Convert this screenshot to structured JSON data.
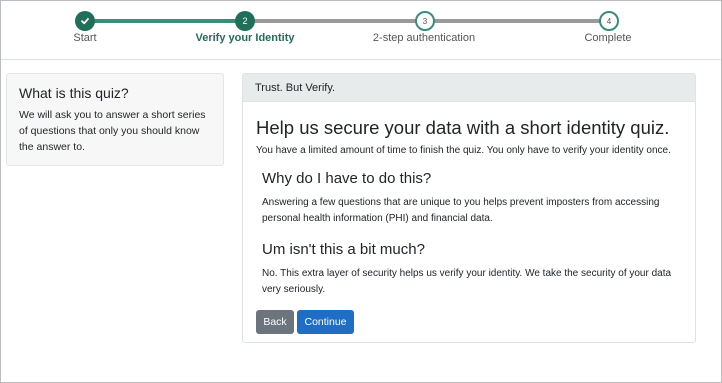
{
  "stepper": {
    "steps": [
      {
        "label": "Start",
        "number": "",
        "state": "done"
      },
      {
        "label": "Verify your Identity",
        "number": "2",
        "state": "active"
      },
      {
        "label": "2-step authentication",
        "number": "3",
        "state": "todo"
      },
      {
        "label": "Complete",
        "number": "4",
        "state": "todo"
      }
    ]
  },
  "sidebar": {
    "title": "What is this quiz?",
    "text": "We will ask you to answer a short series of questions that only you should know the answer to."
  },
  "main": {
    "header": "Trust. But Verify.",
    "title": "Help us secure your data with a short identity quiz.",
    "intro": "You have a limited amount of time to finish the quiz. You only have to verify your identity once.",
    "sections": [
      {
        "heading": "Why do I have to do this?",
        "text": "Answering a few questions that are unique to you helps prevent imposters from accessing personal health information (PHI) and financial data."
      },
      {
        "heading": "Um isn't this a bit much?",
        "text": "No. This extra layer of security helps us verify your identity. We take the security of your data very seriously."
      }
    ],
    "back_label": "Back",
    "continue_label": "Continue"
  },
  "colors": {
    "accent": "#216e5b",
    "primary_button": "#1f6dc5",
    "secondary_button": "#6c757d"
  }
}
